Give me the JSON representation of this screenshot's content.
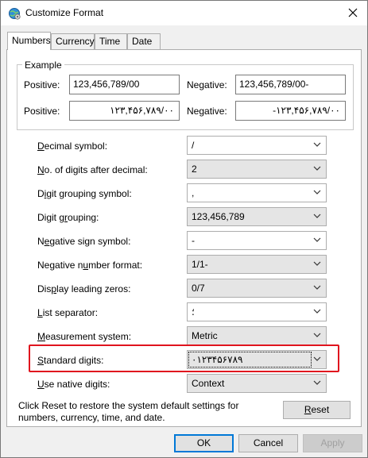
{
  "window": {
    "title": "Customize Format"
  },
  "tabs": [
    {
      "label": "Numbers"
    },
    {
      "label": "Currency"
    },
    {
      "label": "Time"
    },
    {
      "label": "Date"
    }
  ],
  "example": {
    "legend": "Example",
    "row1": {
      "positive_label": "Positive:",
      "positive_value": "123,456,789/00",
      "negative_label": "Negative:",
      "negative_value": "123,456,789/00-"
    },
    "row2": {
      "positive_label": "Positive:",
      "positive_value": "۱۲۳,۴۵۶,۷۸۹/۰۰",
      "negative_label": "Negative:",
      "negative_value": "-۱۲۳,۴۵۶,۷۸۹/۰۰"
    }
  },
  "settings": [
    {
      "label_pre": "",
      "label_key": "D",
      "label_post": "ecimal symbol:",
      "value": "/",
      "editable": true
    },
    {
      "label_pre": "",
      "label_key": "N",
      "label_post": "o. of digits after decimal:",
      "value": "2",
      "editable": false
    },
    {
      "label_pre": "D",
      "label_key": "i",
      "label_post": "git grouping symbol:",
      "value": ",",
      "editable": true
    },
    {
      "label_pre": "Digit g",
      "label_key": "r",
      "label_post": "ouping:",
      "value": "123,456,789",
      "editable": false
    },
    {
      "label_pre": "N",
      "label_key": "e",
      "label_post": "gative sign symbol:",
      "value": "-",
      "editable": true
    },
    {
      "label_pre": "Negative n",
      "label_key": "u",
      "label_post": "mber format:",
      "value": "1/1-",
      "editable": false
    },
    {
      "label_pre": "Dis",
      "label_key": "p",
      "label_post": "lay leading zeros:",
      "value": "0/7",
      "editable": false
    },
    {
      "label_pre": "",
      "label_key": "L",
      "label_post": "ist separator:",
      "value": "؛",
      "editable": true
    },
    {
      "label_pre": "",
      "label_key": "M",
      "label_post": "easurement system:",
      "value": "Metric",
      "editable": false
    },
    {
      "label_pre": "",
      "label_key": "S",
      "label_post": "tandard digits:",
      "value": "۰۱۲۳۴۵۶۷۸۹",
      "editable": false
    },
    {
      "label_pre": "",
      "label_key": "U",
      "label_post": "se native digits:",
      "value": "Context",
      "editable": false
    }
  ],
  "info_text": "Click Reset to restore the system default settings for numbers, currency, time, and date.",
  "buttons": {
    "reset": {
      "key": "R",
      "rest": "eset"
    },
    "ok": "OK",
    "cancel": "Cancel",
    "apply": "Apply"
  },
  "colors": {
    "highlight": "#e0141e",
    "focus": "#0078d7"
  }
}
